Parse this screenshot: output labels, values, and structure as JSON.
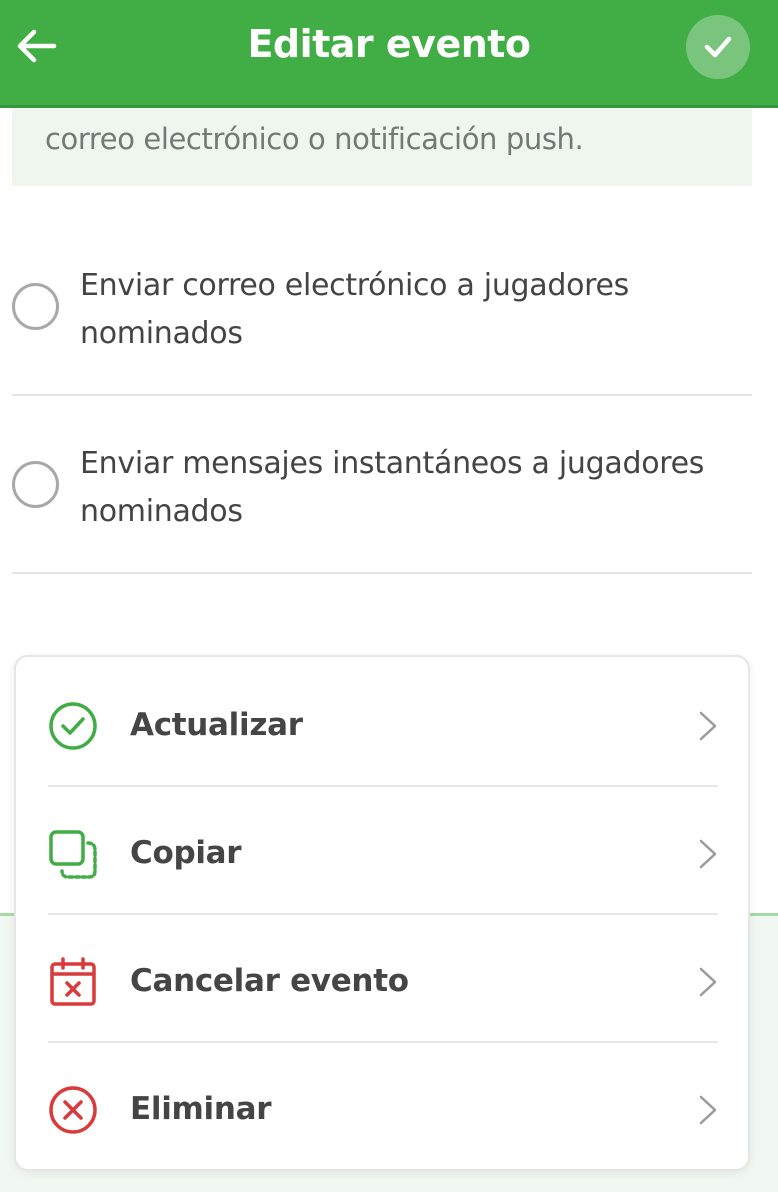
{
  "header": {
    "title": "Editar evento",
    "back_icon": "arrow-left-icon",
    "confirm_icon": "check-icon",
    "color": "#41ad45"
  },
  "info": {
    "text": "correo electrónico o notificación push."
  },
  "options": [
    {
      "label": "Enviar correo electrónico a jugadores nominados",
      "selected": false
    },
    {
      "label": "Enviar mensajes instantáneos a jugadores nominados",
      "selected": false
    }
  ],
  "actions": [
    {
      "label": "Actualizar",
      "icon": "check-circle-icon",
      "icon_color": "#41ad45"
    },
    {
      "label": "Copiar",
      "icon": "copy-icon",
      "icon_color": "#41ad45"
    },
    {
      "label": "Cancelar evento",
      "icon": "calendar-cancel-icon",
      "icon_color": "#d93a3a"
    },
    {
      "label": "Eliminar",
      "icon": "x-circle-icon",
      "icon_color": "#d93a3a"
    }
  ]
}
